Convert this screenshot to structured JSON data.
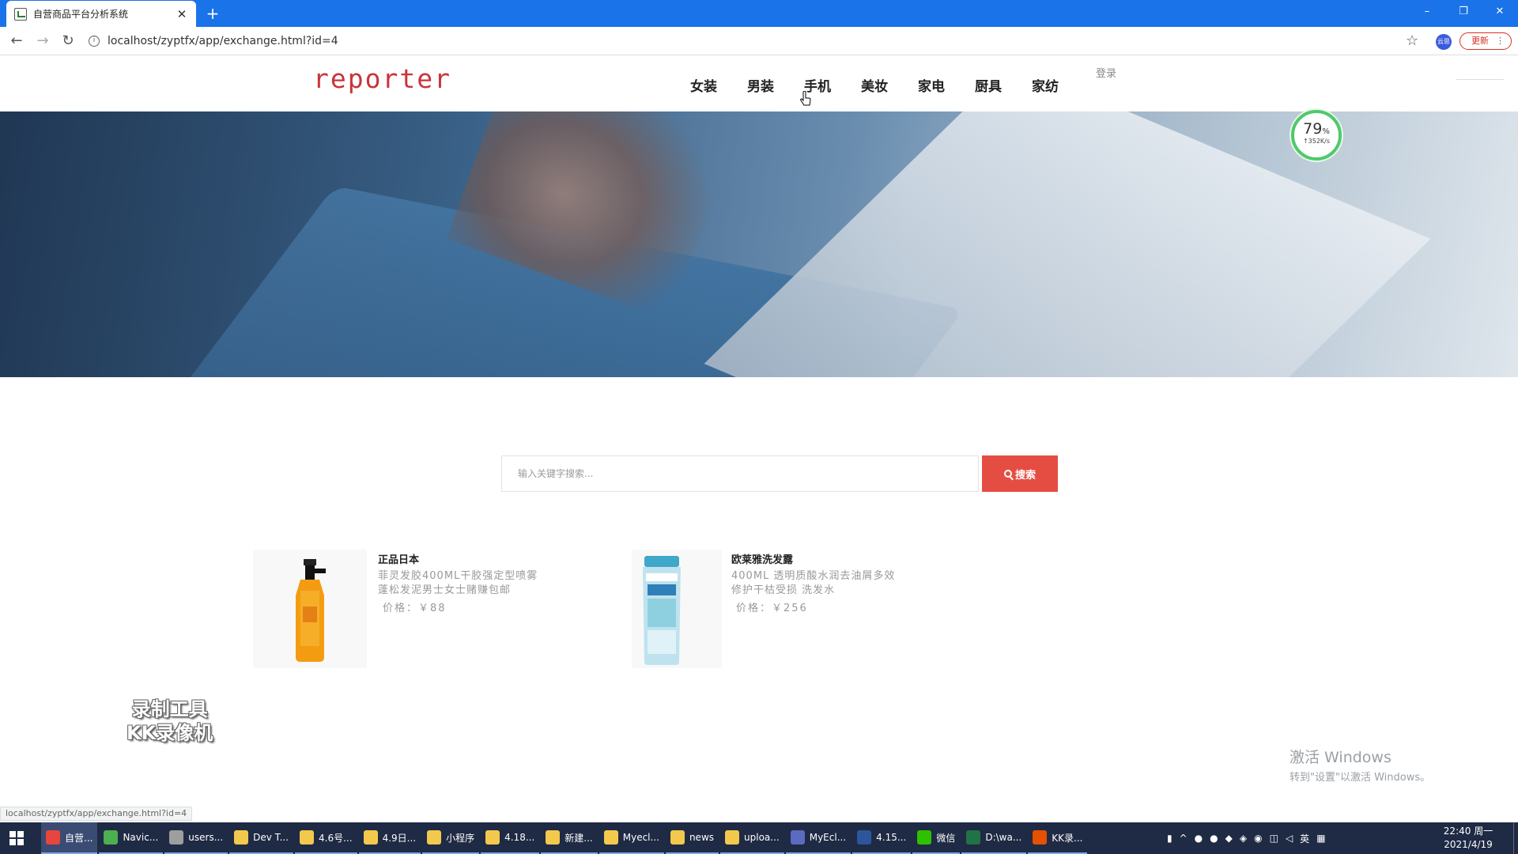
{
  "browser": {
    "tab_title": "自营商品平台分析系统",
    "tab_close": "✕",
    "new_tab": "+",
    "url": "localhost/zyptfx/app/exchange.html?id=4",
    "update_label": "更新",
    "profile_label": "云思",
    "status_url": "localhost/zyptfx/app/exchange.html?id=4",
    "window_controls": [
      "–",
      "❐",
      "✕"
    ]
  },
  "header": {
    "logo": "reporter",
    "nav": [
      "女装",
      "男装",
      "手机",
      "美妆",
      "家电",
      "厨具",
      "家纺"
    ],
    "login": "登录"
  },
  "speed_widget": {
    "percent": "79",
    "percent_unit": "%",
    "rate": "↑352K/s"
  },
  "search": {
    "placeholder": "输入关键字搜索...",
    "button_label": "搜索"
  },
  "products": [
    {
      "name": "正品日本",
      "desc_line1": "菲灵发胶400ML干胶强定型喷雾",
      "desc_line2": "蓬松发泥男士女士赌赚包邮",
      "price": "价格：￥88"
    },
    {
      "name": "欧莱雅洗发露",
      "desc_line1": "400ML 透明质酸水润去油屑多效",
      "desc_line2": "修护干枯受损 洗发水",
      "price": "价格：￥256"
    }
  ],
  "overlay": {
    "watermark_line1": "录制工具",
    "watermark_line2": "KK录像机",
    "activate_title": "激活 Windows",
    "activate_sub": "转到\"设置\"以激活 Windows。"
  },
  "taskbar": {
    "items": [
      {
        "label": "自营...",
        "icon": "chrome-icon",
        "color": "#e8453c"
      },
      {
        "label": "Navic...",
        "icon": "navicat-icon",
        "color": "#4caf50"
      },
      {
        "label": "users...",
        "icon": "db-icon",
        "color": "#9e9e9e"
      },
      {
        "label": "Dev T...",
        "icon": "folder-icon",
        "color": "#f2c94c"
      },
      {
        "label": "4.6号...",
        "icon": "folder-icon",
        "color": "#f2c94c"
      },
      {
        "label": "4.9日...",
        "icon": "folder-icon",
        "color": "#f2c94c"
      },
      {
        "label": "小程序",
        "icon": "folder-icon",
        "color": "#f2c94c"
      },
      {
        "label": "4.18...",
        "icon": "folder-icon",
        "color": "#f2c94c"
      },
      {
        "label": "新建...",
        "icon": "folder-icon",
        "color": "#f2c94c"
      },
      {
        "label": "Myecl...",
        "icon": "folder-icon",
        "color": "#f2c94c"
      },
      {
        "label": "news",
        "icon": "folder-icon",
        "color": "#f2c94c"
      },
      {
        "label": "uploa...",
        "icon": "folder-icon",
        "color": "#f2c94c"
      },
      {
        "label": "MyEcl...",
        "icon": "eclipse-icon",
        "color": "#5c6bc0"
      },
      {
        "label": "4.15...",
        "icon": "word-icon",
        "color": "#2b579a"
      },
      {
        "label": "微信",
        "icon": "wechat-icon",
        "color": "#2dc100"
      },
      {
        "label": "D:\\wa...",
        "icon": "excel-icon",
        "color": "#217346"
      },
      {
        "label": "KK录...",
        "icon": "kk-icon",
        "color": "#e65100"
      }
    ],
    "tray_ime": "英",
    "clock_time": "22:40 周一",
    "clock_date": "2021/4/19"
  },
  "colors": {
    "browser_blue": "#1a73e8",
    "logo_red": "#c9343a",
    "search_button": "#e54d42",
    "taskbar": "#1f2a44"
  }
}
